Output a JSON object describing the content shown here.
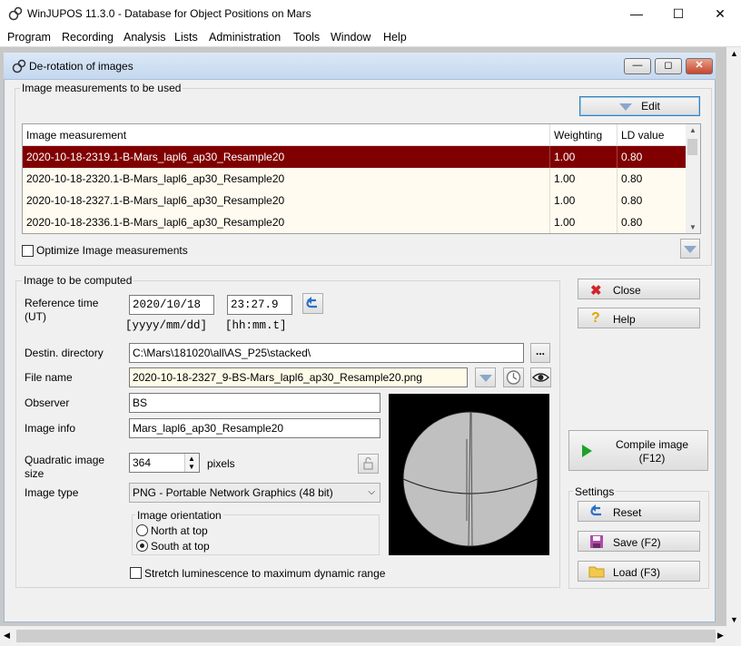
{
  "app": {
    "title": "WinJUPOS 11.3.0 - Database for Object Positions on Mars",
    "minimize": "—",
    "maximize": "☐",
    "close": "✕"
  },
  "menu": [
    "Program",
    "Recording",
    "Analysis",
    "Lists",
    "Administration",
    "Tools",
    "Window",
    "Help"
  ],
  "dialog": {
    "title": "De-rotation of images",
    "min": "—",
    "restore": "◻",
    "close": "✕"
  },
  "measurements": {
    "group_label": "Image measurements to be used",
    "edit_label": "Edit",
    "columns": [
      "Image measurement",
      "Weighting",
      "LD value"
    ],
    "rows": [
      {
        "name": "2020-10-18-2319.1-B-Mars_lapl6_ap30_Resample20",
        "weighting": "1.00",
        "ld": "0.80",
        "selected": true
      },
      {
        "name": "2020-10-18-2320.1-B-Mars_lapl6_ap30_Resample20",
        "weighting": "1.00",
        "ld": "0.80",
        "selected": false
      },
      {
        "name": "2020-10-18-2327.1-B-Mars_lapl6_ap30_Resample20",
        "weighting": "1.00",
        "ld": "0.80",
        "selected": false
      },
      {
        "name": "2020-10-18-2336.1-B-Mars_lapl6_ap30_Resample20",
        "weighting": "1.00",
        "ld": "0.80",
        "selected": false
      }
    ],
    "optimize_label": "Optimize Image measurements"
  },
  "compute": {
    "group_label": "Image to be computed",
    "ref_time_label": "Reference time\n(UT)",
    "date_value": "2020/10/18",
    "time_value": "23:27.9",
    "date_format": "[yyyy/mm/dd]",
    "time_format": "[hh:mm.t]",
    "destin_label": "Destin. directory",
    "destin_value": "C:\\Mars\\181020\\all\\AS_P25\\stacked\\",
    "browse_label": "...",
    "filename_label": "File name",
    "filename_value": "2020-10-18-2327_9-BS-Mars_lapl6_ap30_Resample20.png",
    "observer_label": "Observer",
    "observer_value": "BS",
    "imageinfo_label": "Image info",
    "imageinfo_value": "Mars_lapl6_ap30_Resample20",
    "size_label": "Quadratic image\nsize",
    "size_value": "364",
    "size_unit": "pixels",
    "type_label": "Image type",
    "type_value": "PNG  - Portable Network Graphics (48 bit)",
    "orientation_label": "Image orientation",
    "north_label": "North at top",
    "south_label": "South at top",
    "orientation_selected": "South at top",
    "stretch_label": "Stretch luminescence to maximum dynamic range"
  },
  "side": {
    "close_label": "Close",
    "help_label": "Help",
    "compile_label": "Compile image\n(F12)",
    "settings_label": "Settings",
    "reset_label": "Reset",
    "save_label": "Save (F2)",
    "load_label": "Load (F3)"
  },
  "colors": {
    "selected_row": "#800000",
    "alt_row": "#fffbf0",
    "accent": "#2e7bd6"
  }
}
